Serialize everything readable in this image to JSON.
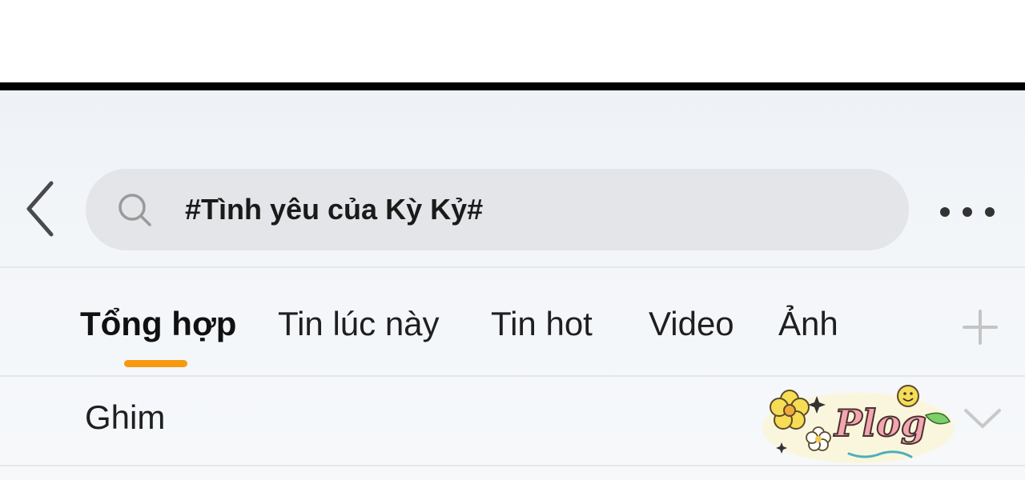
{
  "search": {
    "query": "#Tình yêu của Kỳ Kỷ#"
  },
  "tabs": [
    {
      "label": "Tổng hợp",
      "active": true
    },
    {
      "label": "Tin lúc này",
      "active": false
    },
    {
      "label": "Tin hot",
      "active": false
    },
    {
      "label": "Video",
      "active": false
    },
    {
      "label": "Ảnh",
      "active": false
    }
  ],
  "pinned": {
    "label": "Ghim",
    "badge_text": "Plog"
  },
  "colors": {
    "accent": "#f59a10",
    "search_bg": "#e3e5e8",
    "icon_gray": "#9a9a9a"
  },
  "icons": {
    "back": "chevron-left-icon",
    "search": "search-icon",
    "more": "more-dots-icon",
    "add": "plus-icon",
    "expand": "chevron-down-icon"
  }
}
